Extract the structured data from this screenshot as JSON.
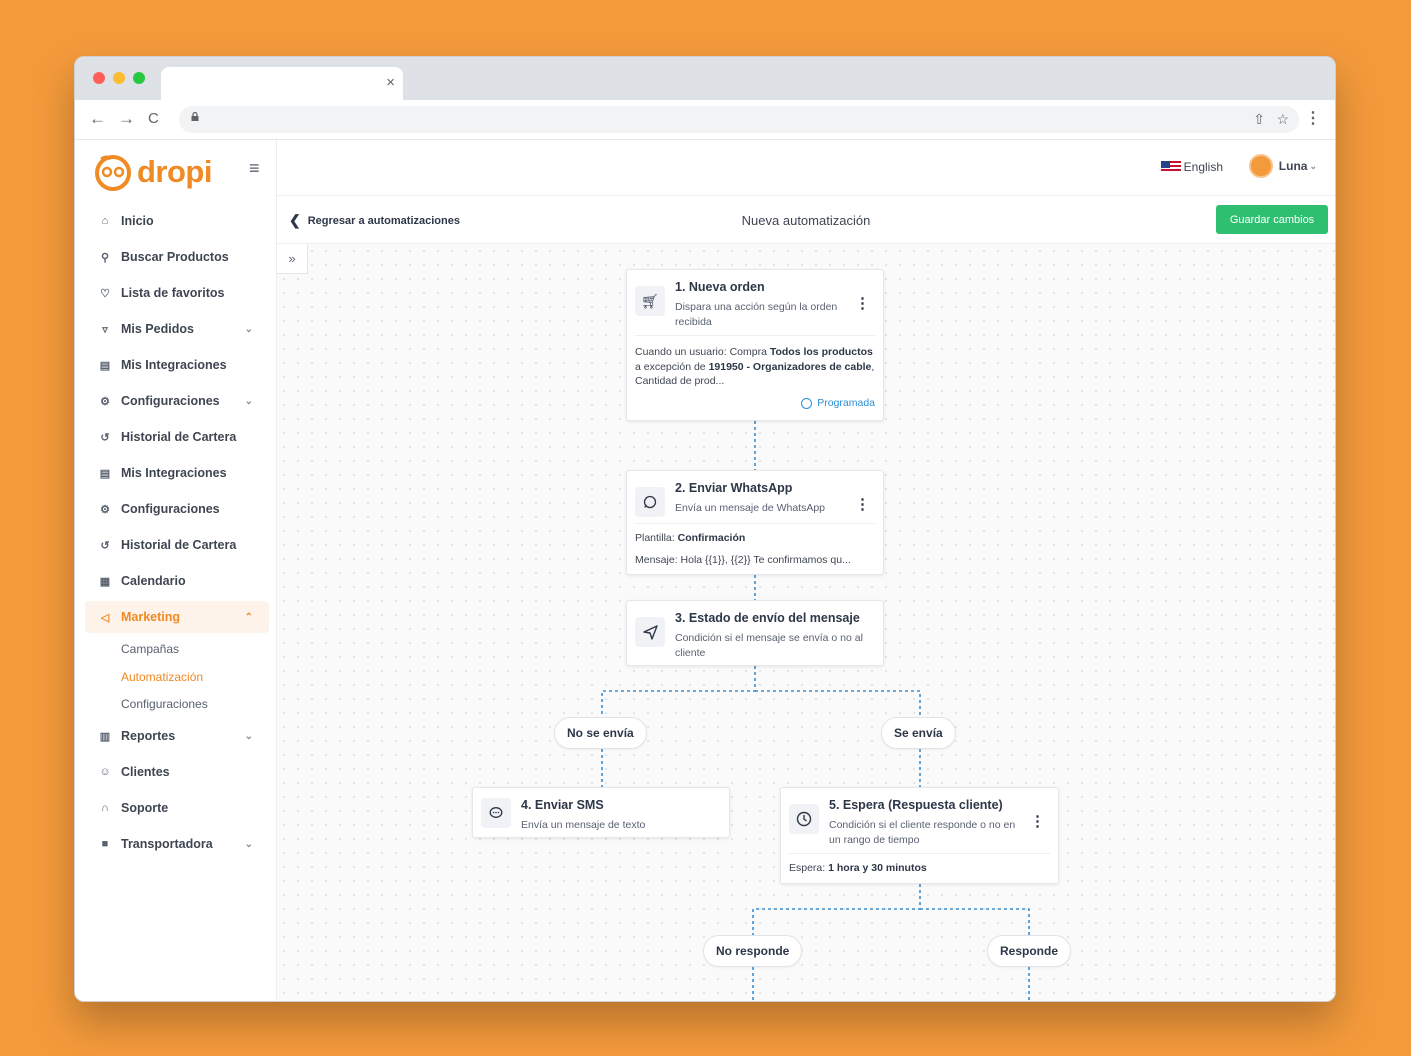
{
  "browser": {
    "close_label": "×",
    "back_icon": "←",
    "forward_icon": "→",
    "reload_icon": "C",
    "share_icon": "⇧",
    "star_icon": "☆",
    "menu_icon": "⋮"
  },
  "brand": {
    "name": "dropi",
    "accent": "#F08A24"
  },
  "sidebar": {
    "items": [
      {
        "label": "Inicio",
        "icon": "home-icon"
      },
      {
        "label": "Buscar Productos",
        "icon": "search-icon"
      },
      {
        "label": "Lista de favoritos",
        "icon": "heart-icon"
      },
      {
        "label": "Mis Pedidos",
        "icon": "cart-icon"
      },
      {
        "label": "Mis Integraciones",
        "icon": "store-icon"
      },
      {
        "label": "Configuraciones",
        "icon": "gear-icon"
      },
      {
        "label": "Historial de Cartera",
        "icon": "history-icon"
      },
      {
        "label": "Mis Integraciones",
        "icon": "store-icon"
      },
      {
        "label": "Configuraciones",
        "icon": "gear-icon"
      },
      {
        "label": "Historial de Cartera",
        "icon": "history-icon"
      },
      {
        "label": "Calendario",
        "icon": "calendar-icon"
      },
      {
        "label": "Marketing",
        "icon": "megaphone-icon"
      },
      {
        "label": "Reportes",
        "icon": "chart-icon"
      },
      {
        "label": "Clientes",
        "icon": "users-icon"
      },
      {
        "label": "Soporte",
        "icon": "headset-icon"
      },
      {
        "label": "Transportadora",
        "icon": "truck-icon"
      }
    ],
    "submenu": [
      "Campañas",
      "Automatización",
      "Configuraciones"
    ]
  },
  "topbar": {
    "language": "English",
    "user": "Luna"
  },
  "subheader": {
    "back_label": "Regresar a automatizaciones",
    "title": "Nueva automatización",
    "save_label": "Guardar cambios"
  },
  "flow": {
    "node1": {
      "title": "1. Nueva orden",
      "desc": "Dispara una acción según la orden recibida",
      "body_prefix": "Cuando un usuario: Compra ",
      "body_bold1": "Todos los productos",
      "body_mid": " a excepción de ",
      "body_bold2": "191950 - Organizadores de cable",
      "body_suffix": ", Cantidad de prod...",
      "status": "Programada"
    },
    "node2": {
      "title": "2. Enviar WhatsApp",
      "desc": "Envía un mensaje de WhatsApp",
      "template_label": "Plantilla: ",
      "template_value": "Confirmación",
      "message": "Mensaje: Hola {{1}}, {{2}} Te confirmamos qu..."
    },
    "node3": {
      "title": "3. Estado de envío del mensaje",
      "desc": "Condición si el mensaje se envía o no al cliente"
    },
    "branch_no_send": "No se envía",
    "branch_send": "Se envía",
    "node4": {
      "title": "4. Enviar SMS",
      "desc": "Envía un mensaje de texto"
    },
    "node5": {
      "title": "5. Espera (Respuesta cliente)",
      "desc": "Condición si el cliente responde o no en un rango de tiempo",
      "wait_label": "Espera: ",
      "wait_value": "1 hora y 30 minutos"
    },
    "branch_no_reply": "No responde",
    "branch_reply": "Responde"
  },
  "colors": {
    "background": "#F39A3B",
    "save": "#2fbf71",
    "link": "#2b8fd6",
    "connector": "#3d8fd1"
  }
}
